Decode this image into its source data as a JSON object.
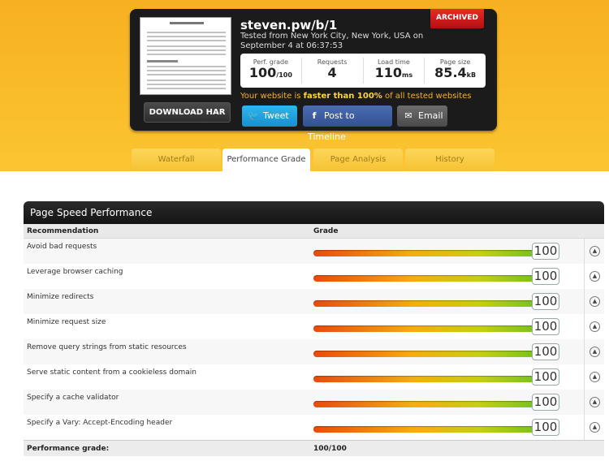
{
  "header": {
    "url": "steven.pw/b/1",
    "tested": "Tested from New York City, New York, USA on September 4 at 06:37:53",
    "archived_label": "ARCHIVED",
    "download_label": "DOWNLOAD HAR",
    "metrics": [
      {
        "label": "Perf. grade",
        "value": "100",
        "unit": "/100"
      },
      {
        "label": "Requests",
        "value": "4",
        "unit": ""
      },
      {
        "label": "Load time",
        "value": "110",
        "unit": "ms"
      },
      {
        "label": "Page size",
        "value": "85.4",
        "unit": "kB"
      }
    ],
    "faster_prefix": "Your website is ",
    "faster_bold": "faster than 100%",
    "faster_suffix": " of all tested websites",
    "share": {
      "tweet": "Tweet",
      "timeline": "Post to Timeline",
      "email": "Email"
    }
  },
  "tabs": [
    {
      "label": "Waterfall"
    },
    {
      "label": "Performance Grade"
    },
    {
      "label": "Page Analysis"
    },
    {
      "label": "History"
    }
  ],
  "active_tab": "Performance Grade",
  "panel": {
    "title": "Page Speed Performance",
    "col_recommendation": "Recommendation",
    "col_grade": "Grade",
    "rows": [
      {
        "recommendation": "Avoid bad requests",
        "grade": "100"
      },
      {
        "recommendation": "Leverage browser caching",
        "grade": "100"
      },
      {
        "recommendation": "Minimize redirects",
        "grade": "100"
      },
      {
        "recommendation": "Minimize request size",
        "grade": "100"
      },
      {
        "recommendation": "Remove query strings from static resources",
        "grade": "100"
      },
      {
        "recommendation": "Serve static content from a cookieless domain",
        "grade": "100"
      },
      {
        "recommendation": "Specify a cache validator",
        "grade": "100"
      },
      {
        "recommendation": "Specify a Vary: Accept-Encoding header",
        "grade": "100"
      }
    ],
    "footer_label": "Performance grade:",
    "footer_value": "100/100"
  },
  "colors": {
    "hero_bg": "#f7b022",
    "archived_ribbon": "#d01c1c",
    "twitter": "#1f9fe0",
    "facebook": "#3d5ea4"
  }
}
